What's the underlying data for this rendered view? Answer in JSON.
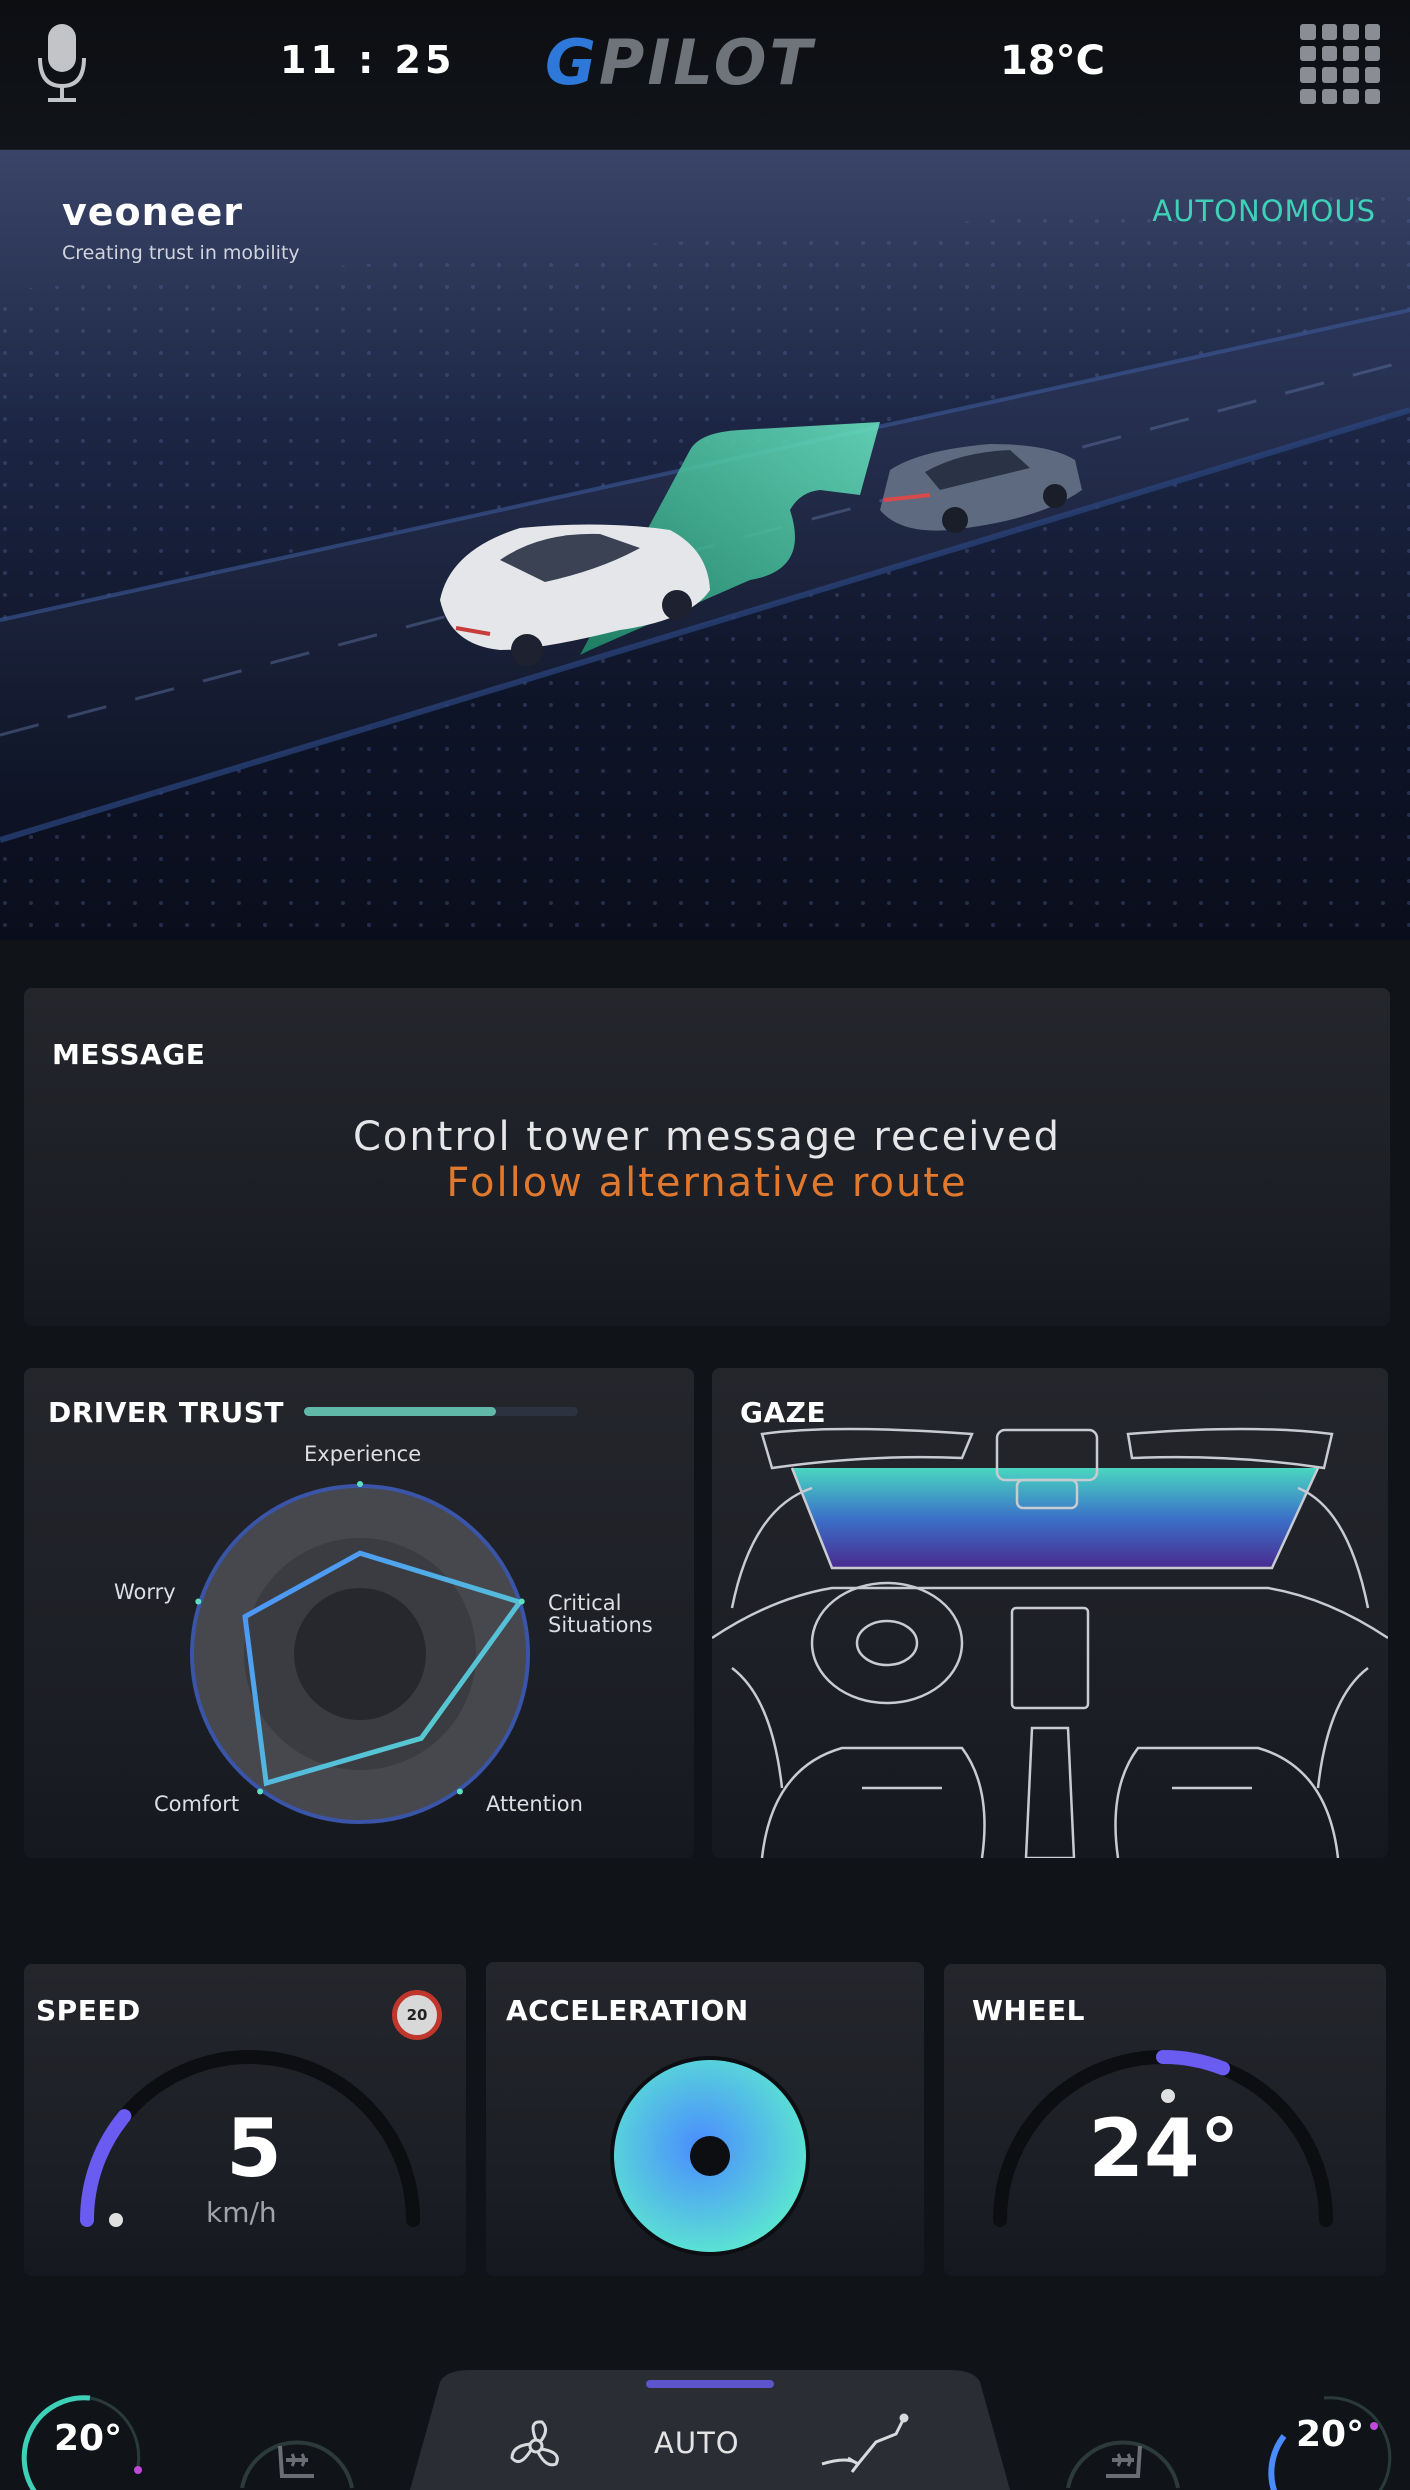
{
  "header": {
    "time": "11 : 25",
    "logo_prefix": "G",
    "logo_rest": "PILOT",
    "temperature": "18°C",
    "icons": [
      "microphone-icon",
      "app-grid-icon"
    ]
  },
  "hero": {
    "brand_name": "veoneer",
    "brand_tagline": "Creating trust in mobility",
    "mode": "AUTONOMOUS"
  },
  "message": {
    "title": "MESSAGE",
    "line1": "Control tower message received",
    "line2": "Follow alternative route",
    "line2_color": "#e0782e"
  },
  "driver_trust": {
    "title": "DRIVER TRUST",
    "trust_level": 0.7,
    "axes": [
      "Experience",
      "Critical Situations",
      "Attention",
      "Comfort",
      "Worry"
    ],
    "axis_labels": {
      "experience": "Experience",
      "critical_line1": "Critical",
      "critical_line2": "Situations",
      "attention": "Attention",
      "comfort": "Comfort",
      "worry": "Worry"
    },
    "values": [
      0.6,
      1.0,
      0.62,
      0.95,
      0.72
    ]
  },
  "gaze": {
    "title": "GAZE"
  },
  "speed": {
    "title": "SPEED",
    "value": "5",
    "unit": "km/h",
    "limit": "20",
    "gauge_fraction": 0.22
  },
  "acceleration": {
    "title": "ACCELERATION"
  },
  "wheel": {
    "title": "WHEEL",
    "angle": "24°",
    "gauge_fraction": 0.12
  },
  "climate": {
    "left_temp": "20°",
    "right_temp": "20°",
    "mode": "AUTO",
    "icons": [
      "seat-heat-left-icon",
      "fan-icon",
      "airflow-icon",
      "seat-heat-right-icon"
    ]
  },
  "colors": {
    "accent_teal": "#3fd0b8",
    "accent_blue": "#4a8cff",
    "gauge_purple": "#6a5cf0",
    "warning_orange": "#e0782e"
  }
}
